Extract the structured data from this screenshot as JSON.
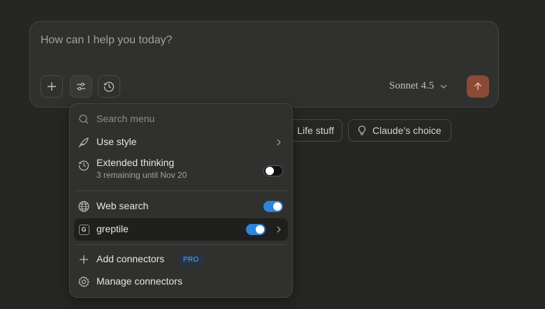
{
  "composer": {
    "placeholder": "How can I help you today?",
    "model": "Sonnet 4.5"
  },
  "chips": [
    {
      "label": "Life stuff"
    },
    {
      "label": "Claude’s choice",
      "icon": "lightbulb-icon"
    }
  ],
  "menu": {
    "search_placeholder": "Search menu",
    "use_style": "Use style",
    "extended_thinking": {
      "label": "Extended thinking",
      "sub": "3 remaining until Nov 20",
      "enabled": false
    },
    "web_search": {
      "label": "Web search",
      "enabled": true
    },
    "greptile": {
      "label": "greptile",
      "badge": "G",
      "enabled": true
    },
    "add_connectors": {
      "label": "Add connectors",
      "badge": "PRO"
    },
    "manage_connectors": "Manage connectors"
  },
  "colors": {
    "accent": "#2c84db",
    "send": "#8a4a36",
    "background": "#262624"
  }
}
